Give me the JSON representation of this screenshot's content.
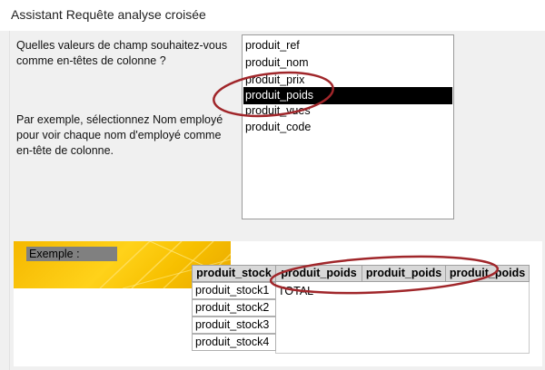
{
  "window": {
    "title": "Assistant Requête analyse croisée"
  },
  "prompt": {
    "question": "Quelles valeurs de champ souhaitez-vous\ncomme en-têtes de colonne ?",
    "example": "Par exemple, sélectionnez Nom employé\npour voir chaque nom d'employé comme\nen-tête de colonne."
  },
  "fields": {
    "items": [
      "produit_ref",
      "produit_nom",
      "produit_prix",
      "produit_poids",
      "produit_vues",
      "produit_code"
    ],
    "selected": "produit_poids"
  },
  "sample": {
    "label": "Exemple :",
    "corner_header": "produit_stock",
    "column_headers": [
      "produit_poids",
      "produit_poids",
      "produit_poids"
    ],
    "row_headers": [
      "produit_stock1",
      "produit_stock2",
      "produit_stock3",
      "produit_stock4"
    ],
    "total_label": "TOTAL"
  },
  "colors": {
    "selection": "#000000",
    "annotation": "#a0262a",
    "banner": "#f7c000"
  }
}
